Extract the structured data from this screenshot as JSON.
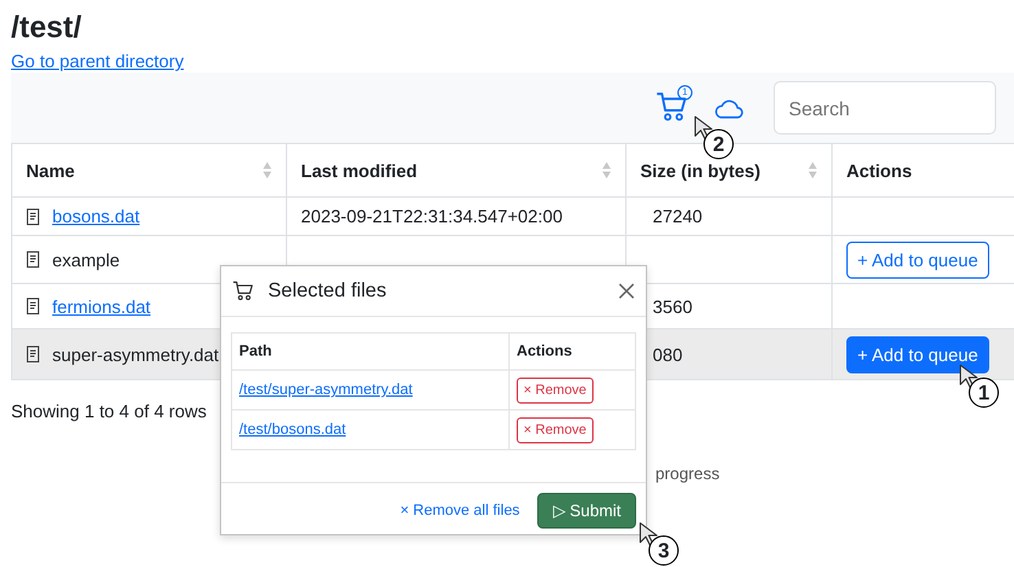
{
  "title": "/test/",
  "parent_link": "Go to parent directory",
  "toolbar": {
    "cart_count": "1",
    "search": {
      "placeholder": "Search"
    }
  },
  "table": {
    "columns": [
      {
        "label": "Name",
        "sortable": true
      },
      {
        "label": "Last modified",
        "sortable": true
      },
      {
        "label": "Size (in bytes)",
        "sortable": true
      },
      {
        "label": "Actions",
        "sortable": false
      }
    ],
    "rows": [
      {
        "name": "bosons.dat",
        "kind": "link",
        "modified": "2023-09-21T22:31:34.547+02:00",
        "size": "27240",
        "highlighted": false
      },
      {
        "name": "example",
        "kind": "plain",
        "action": {
          "label": "+ Add to queue",
          "kind": "outline"
        },
        "highlighted": false
      },
      {
        "name": "fermions.dat",
        "kind": "link",
        "size": "3560",
        "highlighted": false
      },
      {
        "name": "super-asymmetry.dat",
        "kind": "plain",
        "size": "080",
        "action": {
          "label": "+ Add to queue",
          "kind": "solid"
        },
        "highlighted": true
      }
    ]
  },
  "pagination_info": "Showing 1 to 4 of 4 rows",
  "status_fragment": "progress",
  "modal": {
    "title": "Selected files",
    "columns": [
      "Path",
      "Actions"
    ],
    "rows": [
      {
        "path": "/test/super-asymmetry.dat",
        "action": "× Remove"
      },
      {
        "path": "/test/bosons.dat",
        "action": "× Remove"
      }
    ],
    "remove_all": "× Remove all files",
    "submit": "▷ Submit"
  },
  "callouts": [
    {
      "label": "1"
    },
    {
      "label": "2"
    },
    {
      "label": "3"
    }
  ]
}
